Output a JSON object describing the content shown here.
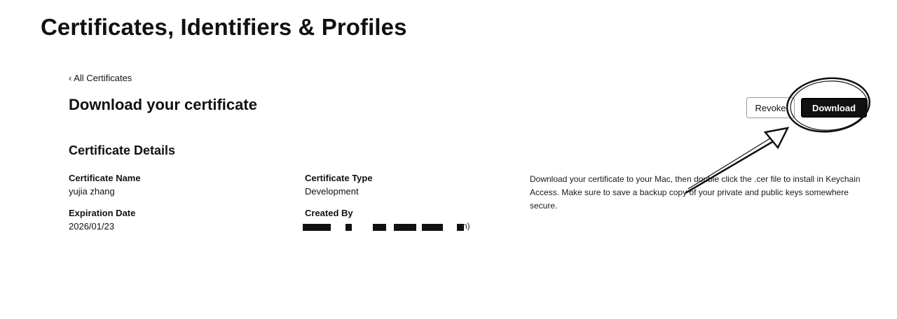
{
  "header": {
    "title": "Certificates, Identifiers & Profiles"
  },
  "nav": {
    "back_label": "‹ All Certificates"
  },
  "page": {
    "title": "Download your certificate"
  },
  "actions": {
    "revoke_label": "Revoke",
    "download_label": "Download"
  },
  "details": {
    "title": "Certificate Details",
    "certificate_name": {
      "label": "Certificate Name",
      "value": "yujia zhang"
    },
    "certificate_type": {
      "label": "Certificate Type",
      "value": "Development"
    },
    "expiration_date": {
      "label": "Expiration Date",
      "value": "2026/01/23"
    },
    "created_by": {
      "label": "Created By",
      "value_visible_end": "n)"
    }
  },
  "info": {
    "text": "Download your certificate to your Mac, then double click the .cer file to install in Keychain Access. Make sure to save a backup copy of your private and public keys somewhere secure."
  },
  "annotation": {
    "color": "#111111"
  }
}
